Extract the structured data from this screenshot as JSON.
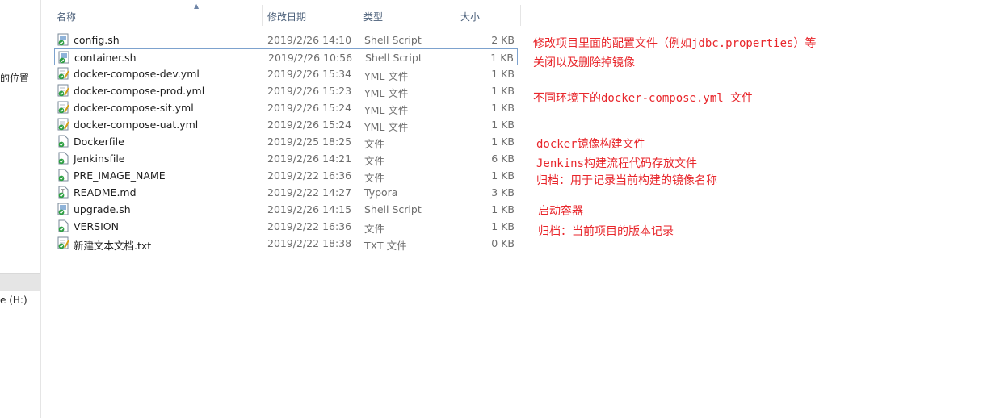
{
  "nav": {
    "partial_location_label": "的位置",
    "partial_drive_label": "e (H:)"
  },
  "columns": {
    "name": "名称",
    "date": "修改日期",
    "type": "类型",
    "size": "大小"
  },
  "files": [
    {
      "name": "config.sh",
      "date": "2019/2/26 14:10",
      "type": "Shell Script",
      "size": "2 KB",
      "icon": "script-file-icon"
    },
    {
      "name": "container.sh",
      "date": "2019/2/26 10:56",
      "type": "Shell Script",
      "size": "1 KB",
      "icon": "script-file-icon",
      "selected": true
    },
    {
      "name": "docker-compose-dev.yml",
      "date": "2019/2/26 15:34",
      "type": "YML 文件",
      "size": "1 KB",
      "icon": "edited-file-icon"
    },
    {
      "name": "docker-compose-prod.yml",
      "date": "2019/2/26 15:23",
      "type": "YML 文件",
      "size": "1 KB",
      "icon": "edited-file-icon"
    },
    {
      "name": "docker-compose-sit.yml",
      "date": "2019/2/26 15:24",
      "type": "YML 文件",
      "size": "1 KB",
      "icon": "edited-file-icon"
    },
    {
      "name": "docker-compose-uat.yml",
      "date": "2019/2/26 15:24",
      "type": "YML 文件",
      "size": "1 KB",
      "icon": "edited-file-icon"
    },
    {
      "name": "Dockerfile",
      "date": "2019/2/25 18:25",
      "type": "文件",
      "size": "1 KB",
      "icon": "blank-file-icon"
    },
    {
      "name": "Jenkinsfile",
      "date": "2019/2/26 14:21",
      "type": "文件",
      "size": "6 KB",
      "icon": "blank-file-icon"
    },
    {
      "name": "PRE_IMAGE_NAME",
      "date": "2019/2/22 16:36",
      "type": "文件",
      "size": "1 KB",
      "icon": "blank-file-icon"
    },
    {
      "name": "README.md",
      "date": "2019/2/22 14:27",
      "type": "Typora",
      "size": "3 KB",
      "icon": "typora-file-icon"
    },
    {
      "name": "upgrade.sh",
      "date": "2019/2/26 14:15",
      "type": "Shell Script",
      "size": "1 KB",
      "icon": "script-file-icon"
    },
    {
      "name": "VERSION",
      "date": "2019/2/22 16:36",
      "type": "文件",
      "size": "1 KB",
      "icon": "blank-file-icon"
    },
    {
      "name": "新建文本文档.txt",
      "date": "2019/2/22 18:38",
      "type": "TXT 文件",
      "size": "0 KB",
      "icon": "edited-file-icon"
    }
  ],
  "annotations": [
    "修改项目里面的配置文件（例如jdbc.properties）等",
    "关闭以及删除掉镜像",
    "不同环境下的docker-compose.yml 文件",
    "docker镜像构建文件",
    "Jenkins构建流程代码存放文件",
    "归档：用于记录当前构建的镜像名称",
    "启动容器",
    "归档：当前项目的版本记录"
  ],
  "colors": {
    "annotation": "#e8262b",
    "header_text": "#4c607a",
    "selection_border": "#7da2ce",
    "svn_check": "#2ea043"
  }
}
